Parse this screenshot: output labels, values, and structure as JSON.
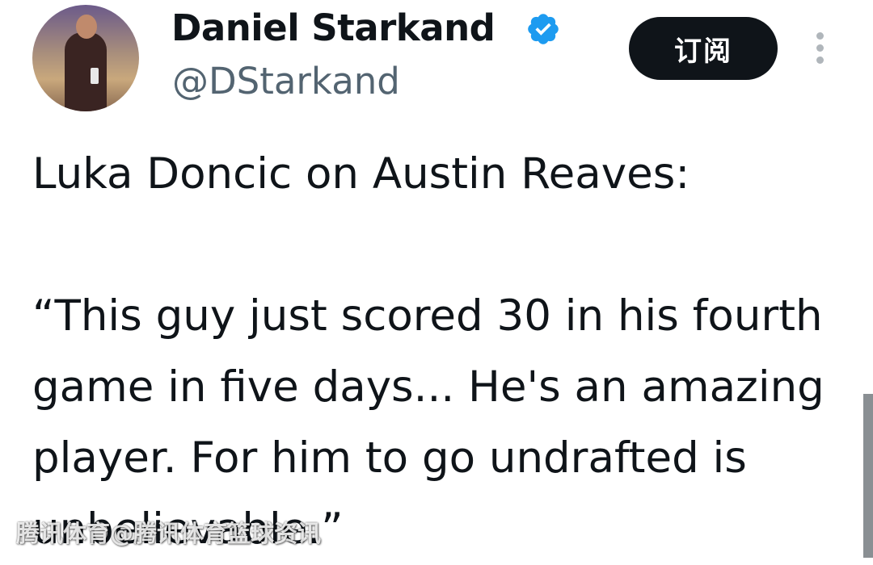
{
  "author": {
    "name": "Daniel Starkand",
    "handle": "@DStarkand",
    "verified_icon": "verified-badge-icon",
    "verified_color": "#1d9bf0"
  },
  "actions": {
    "subscribe_label": "订阅",
    "more_icon": "more-vertical-icon"
  },
  "tweet": {
    "text": "Luka Doncic on Austin Reaves:\n\n“This guy just scored 30 in his fourth game in five days... He's an amazing player. For him to go undrafted is unbelievable.”"
  },
  "watermark": {
    "text": "腾讯体育@腾讯体育篮球资讯"
  },
  "colors": {
    "text": "#0f1419",
    "secondary": "#536471",
    "button_bg": "#0f1419"
  }
}
